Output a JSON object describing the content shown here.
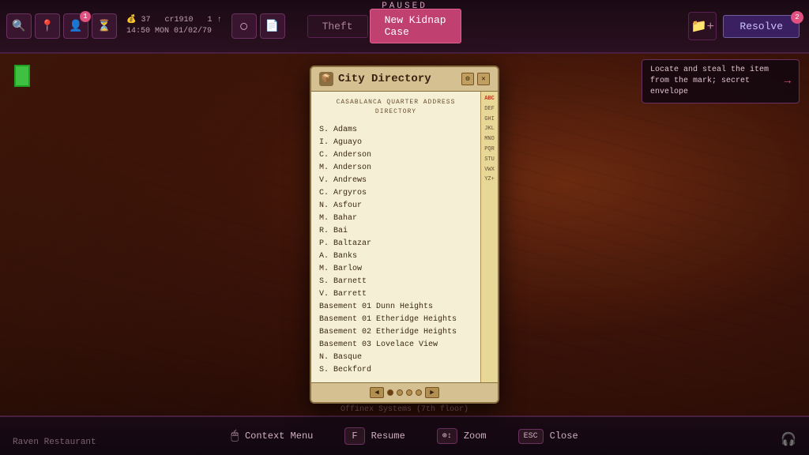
{
  "game": {
    "status": "PAUSED",
    "bottom_location": "Offinex Systems (7th floor)",
    "bottom_left": "Raven Restaurant"
  },
  "topbar": {
    "stats": {
      "money": "37",
      "cr": "cr1910",
      "level": "1",
      "time": "14:50 MON 01/02/79"
    },
    "tabs": [
      {
        "label": "Theft",
        "state": "normal"
      },
      {
        "label": "New Kidnap\nCase",
        "state": "active"
      }
    ],
    "resolve_label": "Resolve",
    "resolve_badge": "2",
    "notification_badge": "1"
  },
  "tooltip": {
    "text": "Locate and steal the item from the mark; secret envelope"
  },
  "directory": {
    "title": "City Directory",
    "subtitle_line1": "CASABLANCA QUARTER ADDRESS",
    "subtitle_line2": "DIRECTORY",
    "entries": [
      "S. Adams",
      "I. Aguayo",
      "C. Anderson",
      "M. Anderson",
      "V. Andrews",
      "C. Argyros",
      "N. Asfour",
      "M. Bahar",
      "R. Bai",
      "P. Baltazar",
      "A. Banks",
      "M. Barlow",
      "S. Barnett",
      "V. Barrett",
      "Basement 01 Dunn Heights",
      "Basement 01 Etheridge Heights",
      "Basement 02 Etheridge Heights",
      "Basement 03 Lovelace View",
      "N. Basque",
      "S. Beckford"
    ],
    "alphabet": [
      "ABC",
      "DEF",
      "GHI",
      "JKL",
      "MNO",
      "PQR",
      "STU",
      "VWX",
      "YZ+"
    ],
    "active_alpha": "ABC",
    "pages": 4,
    "current_page": 1
  },
  "bottom_actions": [
    {
      "key": "🖱",
      "label": "Context Menu",
      "type": "mouse"
    },
    {
      "key": "F",
      "label": "Resume"
    },
    {
      "key": "⊕↕",
      "label": "Zoom",
      "type": "special"
    },
    {
      "key": "ESC",
      "label": "Close",
      "type": "special"
    }
  ]
}
